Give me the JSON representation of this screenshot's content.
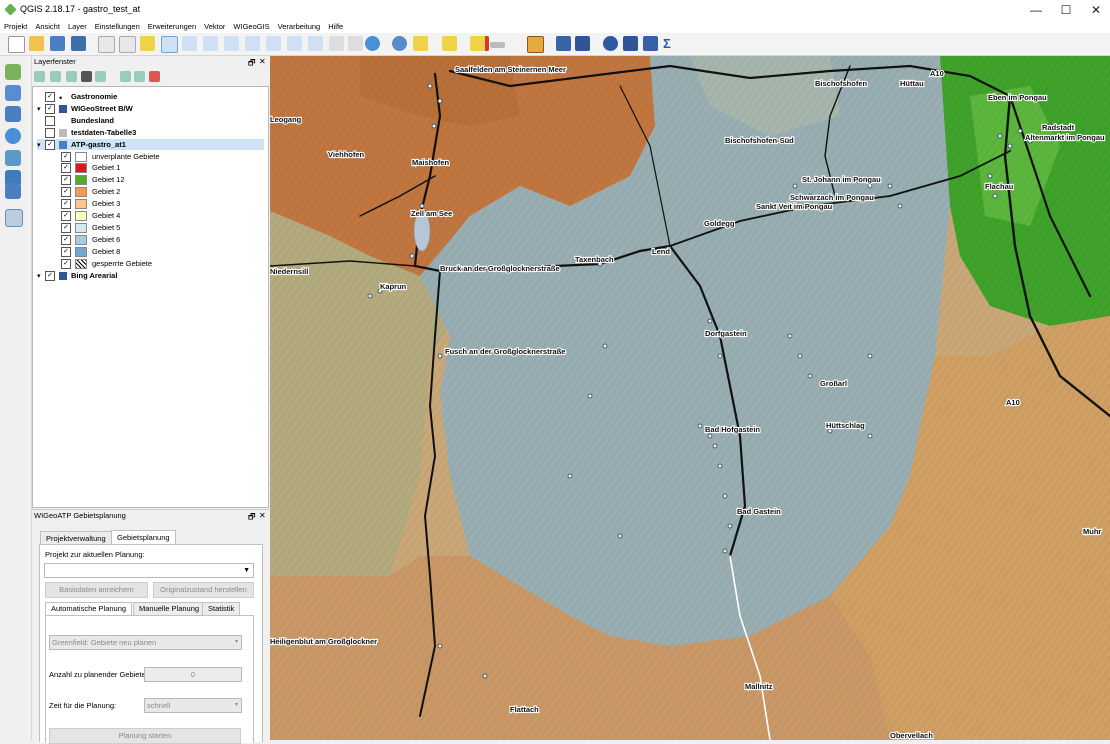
{
  "window": {
    "title": "QGIS 2.18.17 - gastro_test_at"
  },
  "menu": [
    "Projekt",
    "Ansicht",
    "Layer",
    "Einstellungen",
    "Erweiterungen",
    "Vektor",
    "WIGeoGIS",
    "Verarbeitung",
    "Hilfe"
  ],
  "layer_panel": {
    "title": "Layerfenster",
    "layers": [
      {
        "label": "Gastronomie",
        "checked": true,
        "bold": true,
        "indent": 0
      },
      {
        "label": "WIGeoStreet B/W",
        "checked": true,
        "bold": true,
        "indent": 0
      },
      {
        "label": "Bundesland",
        "checked": false,
        "bold": true,
        "indent": 0
      },
      {
        "label": "testdaten-Tabelle3",
        "checked": false,
        "bold": true,
        "indent": 0
      },
      {
        "label": "ATP-gastro_at1",
        "checked": true,
        "bold": true,
        "indent": 0,
        "selected": true
      },
      {
        "label": "unverplante Gebiete",
        "checked": true,
        "color": "#ffffff",
        "indent": 1
      },
      {
        "label": "Gebiet 1",
        "checked": true,
        "color": "#d7191c",
        "indent": 1
      },
      {
        "label": "Gebiet 12",
        "checked": true,
        "color": "#4daf28",
        "indent": 1
      },
      {
        "label": "Gebiet 2",
        "checked": true,
        "color": "#f59a55",
        "indent": 1
      },
      {
        "label": "Gebiet 3",
        "checked": true,
        "color": "#fdc589",
        "indent": 1
      },
      {
        "label": "Gebiet 4",
        "checked": true,
        "color": "#ffffbf",
        "indent": 1
      },
      {
        "label": "Gebiet 5",
        "checked": true,
        "color": "#d2e9f2",
        "indent": 1
      },
      {
        "label": "Gebiet 6",
        "checked": true,
        "color": "#a6cde3",
        "indent": 1
      },
      {
        "label": "Gebiet 8",
        "checked": true,
        "color": "#6fa7d0",
        "indent": 1
      },
      {
        "label": "gesperrte Gebiete",
        "checked": true,
        "color": "pattern",
        "indent": 1
      },
      {
        "label": "Bing Arearial",
        "checked": true,
        "bold": true,
        "indent": 0
      }
    ]
  },
  "plan_panel": {
    "title": "WIGeoATP Gebietsplanung",
    "tabs": [
      "Projektverwaltung",
      "Gebietsplanung"
    ],
    "project_label": "Projekt zur aktuellen Planung:",
    "project_value": "",
    "btn_enrich": "Basisdaten anreichern",
    "btn_restore": "Originalzustand herstellen",
    "subtabs": [
      "Automatische Planung",
      "Manuelle Planung",
      "Statistik"
    ],
    "mode_value": "Greenfield: Gebiete neu planen",
    "count_label": "Anzahl zu planender Gebiete:",
    "count_value": "0",
    "time_label": "Zeit für die Planung:",
    "time_value": "schnell",
    "btn_start": "Planung starten"
  },
  "map": {
    "labels": [
      {
        "text": "Saalfelden am Steinernen Meer"
      },
      {
        "text": "Bischofshofen"
      },
      {
        "text": "Hüttau"
      },
      {
        "text": "A10"
      },
      {
        "text": "Eben im Pongau"
      },
      {
        "text": "Radstadt"
      },
      {
        "text": "Altenmarkt im Pongau"
      },
      {
        "text": "Flachau"
      },
      {
        "text": "Leogang"
      },
      {
        "text": "Viehhofen"
      },
      {
        "text": "Maishofen"
      },
      {
        "text": "St. Johann im Pongau"
      },
      {
        "text": "Schwarzach im Pongau"
      },
      {
        "text": "Sankt Veit im Pongau"
      },
      {
        "text": "Goldegg"
      },
      {
        "text": "Bischofshofen-Süd"
      },
      {
        "text": "Zell am See"
      },
      {
        "text": "Niedernsill"
      },
      {
        "text": "Bruck an der Großglocknerstraße"
      },
      {
        "text": "Taxenbach"
      },
      {
        "text": "Lend"
      },
      {
        "text": "Kaprun"
      },
      {
        "text": "Dorfgastein"
      },
      {
        "text": "Fusch an der Großglocknerstraße"
      },
      {
        "text": "Bad Hofgastein"
      },
      {
        "text": "Hüttschlag"
      },
      {
        "text": "A10"
      },
      {
        "text": "Bad Gastein"
      },
      {
        "text": "Muhr"
      },
      {
        "text": "Heiligenblut am Großglockner"
      },
      {
        "text": "Mallnitz"
      },
      {
        "text": "Flattach"
      },
      {
        "text": "Obervellach"
      },
      {
        "text": "Großarl"
      }
    ]
  },
  "colors": {
    "region_orange": "#c1763f",
    "region_green": "#3fa22b",
    "region_blue": "#98aeb2",
    "region_tan": "#c9a778"
  }
}
